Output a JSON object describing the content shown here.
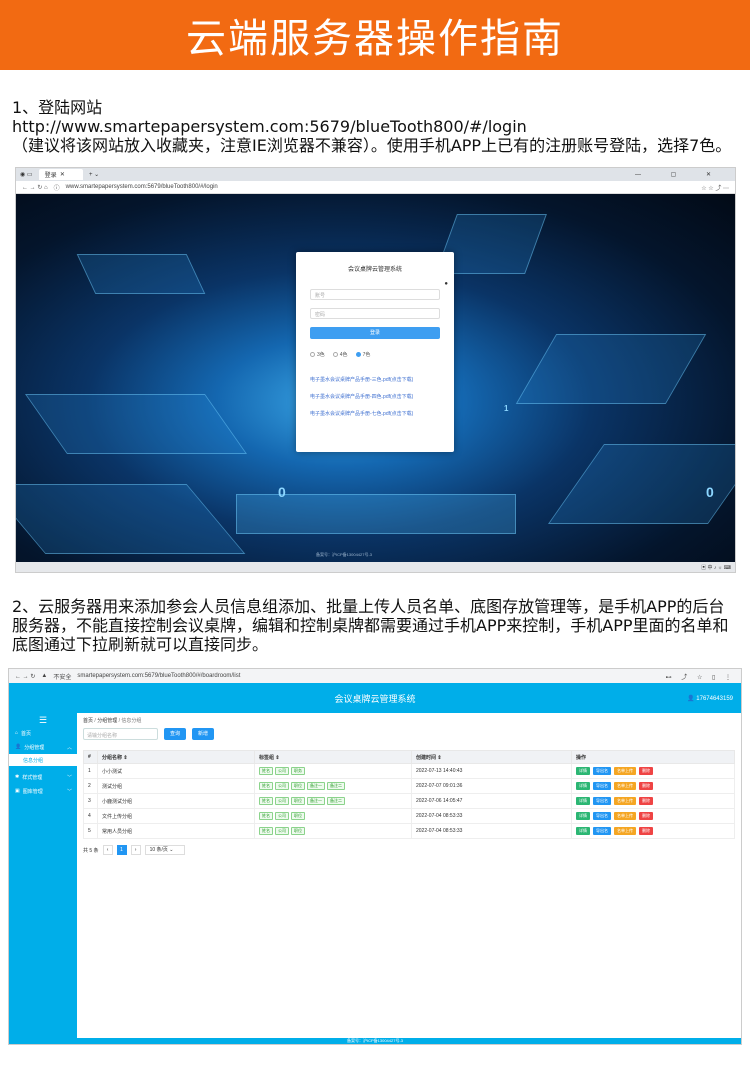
{
  "banner": {
    "title": "云端服务器操作指南"
  },
  "step1": {
    "heading": "1、登陆网站",
    "url": "http://www.smartepapersystem.com:5679/blueTooth800/#/login",
    "note": "（建议将该网站放入收藏夹，注意IE浏览器不兼容）。使用手机APP上已有的注册账号登陆，选择7色。"
  },
  "browser1": {
    "tab_label": "登录",
    "address": "www.smartepapersystem.com:5679/blueTooth800/#/login"
  },
  "login": {
    "title": "会议桌牌云管理系统",
    "account_placeholder": "账号",
    "password_placeholder": "密码",
    "button": "登录",
    "opt3": "3色",
    "opt4": "4色",
    "opt7": "7色",
    "link1": "电子墨水会议桌牌产品手册-三色.pdf(点击下载)",
    "link2": "电子墨水会议桌牌产品手册-四色.pdf(点击下载)",
    "link3": "电子墨水会议桌牌产品手册-七色.pdf(点击下载)",
    "footer": "备案号：沪ICP备13004427号-3"
  },
  "step2": {
    "text": "2、云服务器用来添加参会人员信息组添加、批量上传人员名单、底图存放管理等，是手机APP的后台服务器，不能直接控制会议桌牌，编辑和控制桌牌都需要通过手机APP来控制，手机APP里面的名单和底图通过下拉刷新就可以直接同步。"
  },
  "browser2": {
    "security": "不安全",
    "address": "smartepapersystem.com:5679/blueTooth800/#/boardroom/list"
  },
  "admin": {
    "title": "会议桌牌云管理系统",
    "user": "17674643159",
    "menu": {
      "home": "首页",
      "group": "分组管理",
      "group_sub": "信息分组",
      "style": "样式管理",
      "image": "图库管理"
    },
    "crumbs": [
      "首页",
      "分组管理",
      "信息分组"
    ],
    "search_placeholder": "请输分组名称",
    "search_btn": "查询",
    "add_btn": "新增",
    "columns": [
      "#",
      "分组名称",
      "标签组",
      "创建时间",
      "操作"
    ],
    "rows": [
      {
        "no": "1",
        "name": "小小测试",
        "tags": [
          "姓名",
          "公司",
          "职务"
        ],
        "time": "2022-07-13 14:40:43"
      },
      {
        "no": "2",
        "name": "测试分组",
        "tags": [
          "姓名",
          "公司",
          "职位",
          "备注一",
          "备注二"
        ],
        "time": "2022-07-07 09:01:36"
      },
      {
        "no": "3",
        "name": "小鹿测试分组",
        "tags": [
          "姓名",
          "公司",
          "职位",
          "备注一",
          "备注二"
        ],
        "time": "2022-07-06 14:05:47"
      },
      {
        "no": "4",
        "name": "文件上传分组",
        "tags": [
          "姓名",
          "公司",
          "职位"
        ],
        "time": "2022-07-04 08:53:33"
      },
      {
        "no": "5",
        "name": "常用人员分组",
        "tags": [
          "姓名",
          "公司",
          "职位"
        ],
        "time": "2022-07-04 08:53:33"
      }
    ],
    "ops": [
      "详情",
      "导出名",
      "名单上传",
      "删除"
    ],
    "total": "共 5 条",
    "page": "1",
    "page_size": "10 条/页",
    "footer": "备案号：沪ICP备13004427号-3"
  }
}
